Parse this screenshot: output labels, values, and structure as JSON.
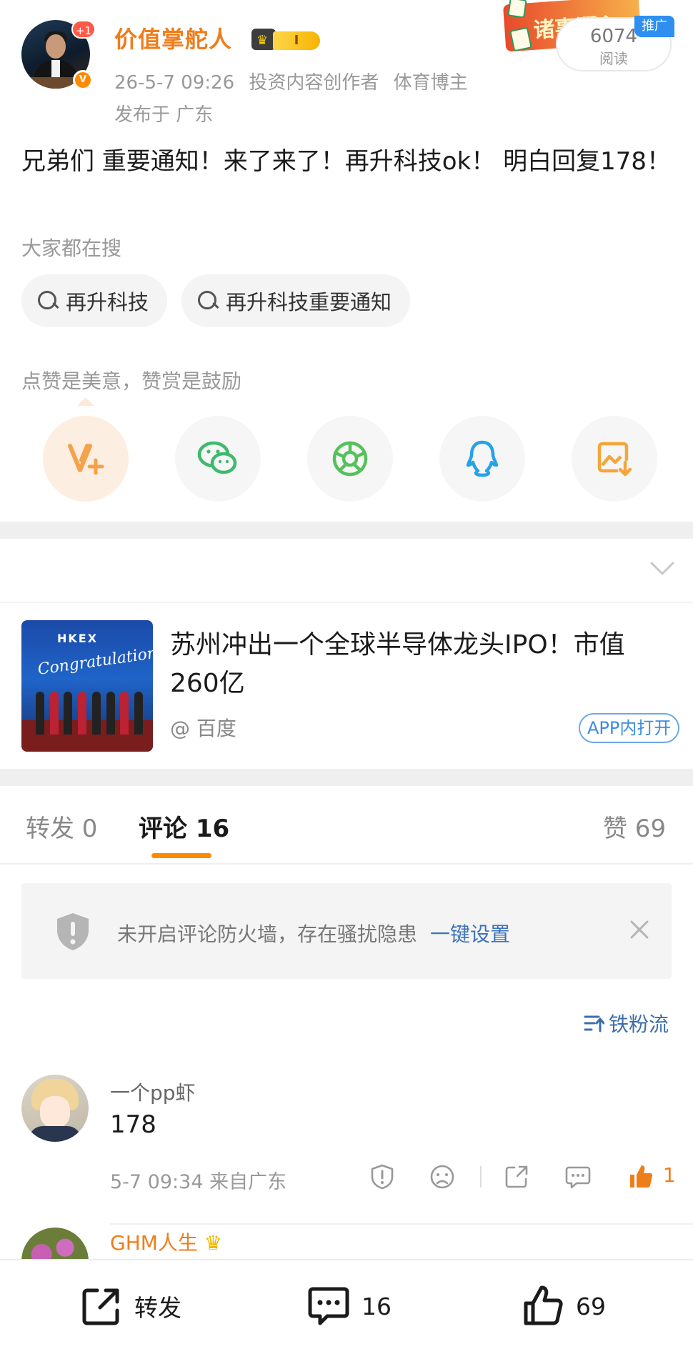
{
  "post": {
    "avatar_badge": "+1",
    "author": "价值掌舵人",
    "level_badge": "I",
    "time": "26-5-7 09:26",
    "tags": [
      "投资内容创作者",
      "体育博主"
    ],
    "location": "发布于 广东",
    "promo": {
      "banner_text": "诸事顺心",
      "views": "6074",
      "views_label": "阅读",
      "tag": "推广"
    },
    "content": "兄弟们 重要通知！来了来了！再升科技ok！ 明白回复178！",
    "search_title": "大家都在搜",
    "search_chips": [
      "再升科技",
      "再升科技重要通知"
    ],
    "reward_caption": "点赞是美意，赞赏是鼓励",
    "share_icons": [
      "reward-icon",
      "wechat-icon",
      "moments-icon",
      "qq-icon",
      "save-image-icon"
    ]
  },
  "card": {
    "thumb_header": "HKEX",
    "thumb_caption": "Congratulations!",
    "title": "苏州冲出一个全球半导体龙头IPO！市值260亿",
    "source": "@ 百度",
    "open_label": "APP内打开"
  },
  "tabs": {
    "repost": "转发 0",
    "comments": "评论 16",
    "likes": "赞 69"
  },
  "notice": {
    "message": "未开启评论防火墙，存在骚扰隐患",
    "link": "一键设置"
  },
  "sort_label": "铁粉流",
  "comments": [
    {
      "user": "一个pp虾",
      "text": "178",
      "meta": "5-7 09:34 来自广东",
      "likes": "1"
    },
    {
      "user": "GHM人生",
      "text": "",
      "meta": "",
      "likes": ""
    }
  ],
  "bottom_bar": {
    "repost": "转发",
    "comments": "16",
    "likes": "69"
  },
  "colors": {
    "accent": "#ef7d1b",
    "link": "#3c73b8",
    "tab_underline": "#ff8a00"
  }
}
